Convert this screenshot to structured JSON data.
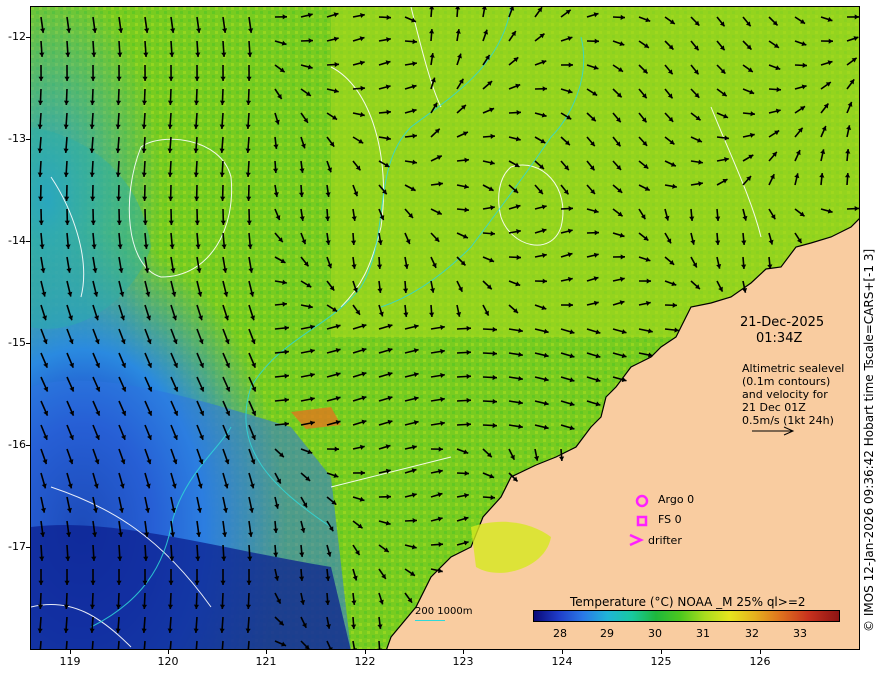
{
  "map": {
    "date": "21-Dec-2025",
    "time": "01:34Z",
    "altimetry_note": [
      "Altimetric sealevel",
      "(0.1m contours)",
      "and velocity for",
      "21 Dec 01Z",
      "0.5m/s (1kt 24h)"
    ],
    "lat_ticks": [
      "-12",
      "-13",
      "-14",
      "-15",
      "-16",
      "-17"
    ],
    "lon_ticks": [
      "119",
      "120",
      "121",
      "122",
      "123",
      "124",
      "125",
      "126"
    ],
    "legend": {
      "argo": "Argo 0",
      "fs": "FS 0",
      "drifter": "drifter"
    },
    "colorbar": {
      "title": "Temperature (°C) NOAA _M 25% ql>=2",
      "ticks": [
        "28",
        "29",
        "30",
        "31",
        "32",
        "33"
      ]
    },
    "depth_labels": "200  1000m",
    "credit": "© IMOS 12-Jan-2026 09:36:42 Hobart time Tscale=CARS+[-1 3]",
    "colors": {
      "land": "#f9cca0",
      "warm_sst": "#9ad61e",
      "cool_sst": "#2a78e6",
      "cold_sst": "#0a1a8c",
      "markers": "#ff20ff",
      "contour": "#ffffff",
      "bathymetry": "#30d8d8"
    }
  }
}
